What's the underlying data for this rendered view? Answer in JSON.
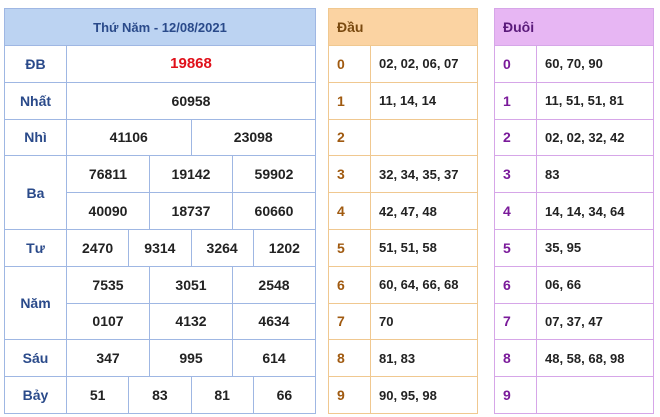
{
  "results": {
    "title": "Thứ Năm - 12/08/2021",
    "special": {
      "label": "ĐB",
      "value": "19868"
    },
    "first": {
      "label": "Nhất",
      "value": "60958"
    },
    "second": {
      "label": "Nhì",
      "values": [
        "41106",
        "23098"
      ]
    },
    "third": {
      "label": "Ba",
      "row1": [
        "76811",
        "19142",
        "59902"
      ],
      "row2": [
        "40090",
        "18737",
        "60660"
      ]
    },
    "fourth": {
      "label": "Tư",
      "values": [
        "2470",
        "9314",
        "3264",
        "1202"
      ]
    },
    "fifth": {
      "label": "Năm",
      "row1": [
        "7535",
        "3051",
        "2548"
      ],
      "row2": [
        "0107",
        "4132",
        "4634"
      ]
    },
    "sixth": {
      "label": "Sáu",
      "values": [
        "347",
        "995",
        "614"
      ]
    },
    "seventh": {
      "label": "Bảy",
      "values": [
        "51",
        "83",
        "81",
        "66"
      ]
    }
  },
  "head": {
    "title": "Đầu",
    "rows": [
      {
        "idx": "0",
        "val": "02, 02, 06, 07"
      },
      {
        "idx": "1",
        "val": "11, 14, 14"
      },
      {
        "idx": "2",
        "val": ""
      },
      {
        "idx": "3",
        "val": "32, 34, 35, 37"
      },
      {
        "idx": "4",
        "val": "42, 47, 48"
      },
      {
        "idx": "5",
        "val": "51, 51, 58"
      },
      {
        "idx": "6",
        "val": "60, 64, 66, 68"
      },
      {
        "idx": "7",
        "val": "70"
      },
      {
        "idx": "8",
        "val": "81, 83"
      },
      {
        "idx": "9",
        "val": "90, 95, 98"
      }
    ]
  },
  "tail": {
    "title": "Đuôi",
    "rows": [
      {
        "idx": "0",
        "val": "60, 70, 90"
      },
      {
        "idx": "1",
        "val": "11, 51, 51, 81"
      },
      {
        "idx": "2",
        "val": "02, 02, 32, 42"
      },
      {
        "idx": "3",
        "val": "83"
      },
      {
        "idx": "4",
        "val": "14, 14, 34, 64"
      },
      {
        "idx": "5",
        "val": "35, 95"
      },
      {
        "idx": "6",
        "val": "06, 66"
      },
      {
        "idx": "7",
        "val": "07, 37, 47"
      },
      {
        "idx": "8",
        "val": "48, 58, 68, 98"
      },
      {
        "idx": "9",
        "val": ""
      }
    ]
  },
  "colors": {
    "results_header": "#bcd3f2",
    "head_header": "#fbd3a2",
    "tail_header": "#e7b6f3",
    "special_prize": "#e0101a"
  }
}
